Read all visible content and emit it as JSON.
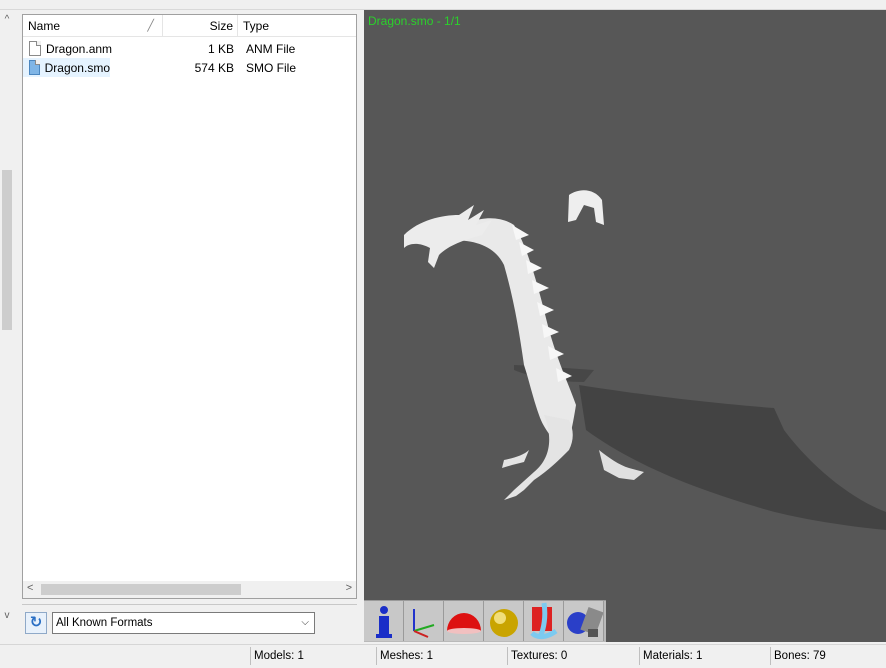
{
  "file_list": {
    "columns": {
      "name": "Name",
      "size": "Size",
      "type": "Type"
    },
    "rows": [
      {
        "name": "Dragon.anm",
        "size": "1 KB",
        "type": "ANM File",
        "icon": "blank-file-icon",
        "selected": false
      },
      {
        "name": "Dragon.smo",
        "size": "574 KB",
        "type": "SMO File",
        "icon": "model-file-icon",
        "selected": true
      }
    ]
  },
  "filter": {
    "selected": "All Known Formats"
  },
  "viewport": {
    "title": "Dragon.smo - 1/1",
    "title_color": "#2bd12b",
    "background": "#575757"
  },
  "toolbar": {
    "buttons": [
      {
        "name": "info-icon"
      },
      {
        "name": "axes-icon"
      },
      {
        "name": "red-hemisphere-icon"
      },
      {
        "name": "gold-sphere-icon"
      },
      {
        "name": "texture-icon"
      },
      {
        "name": "bone-sphere-icon"
      }
    ]
  },
  "status": {
    "left": "",
    "models": "Models: 1",
    "meshes": "Meshes: 1",
    "textures": "Textures: 0",
    "materials": "Materials: 1",
    "bones": "Bones: 79"
  }
}
